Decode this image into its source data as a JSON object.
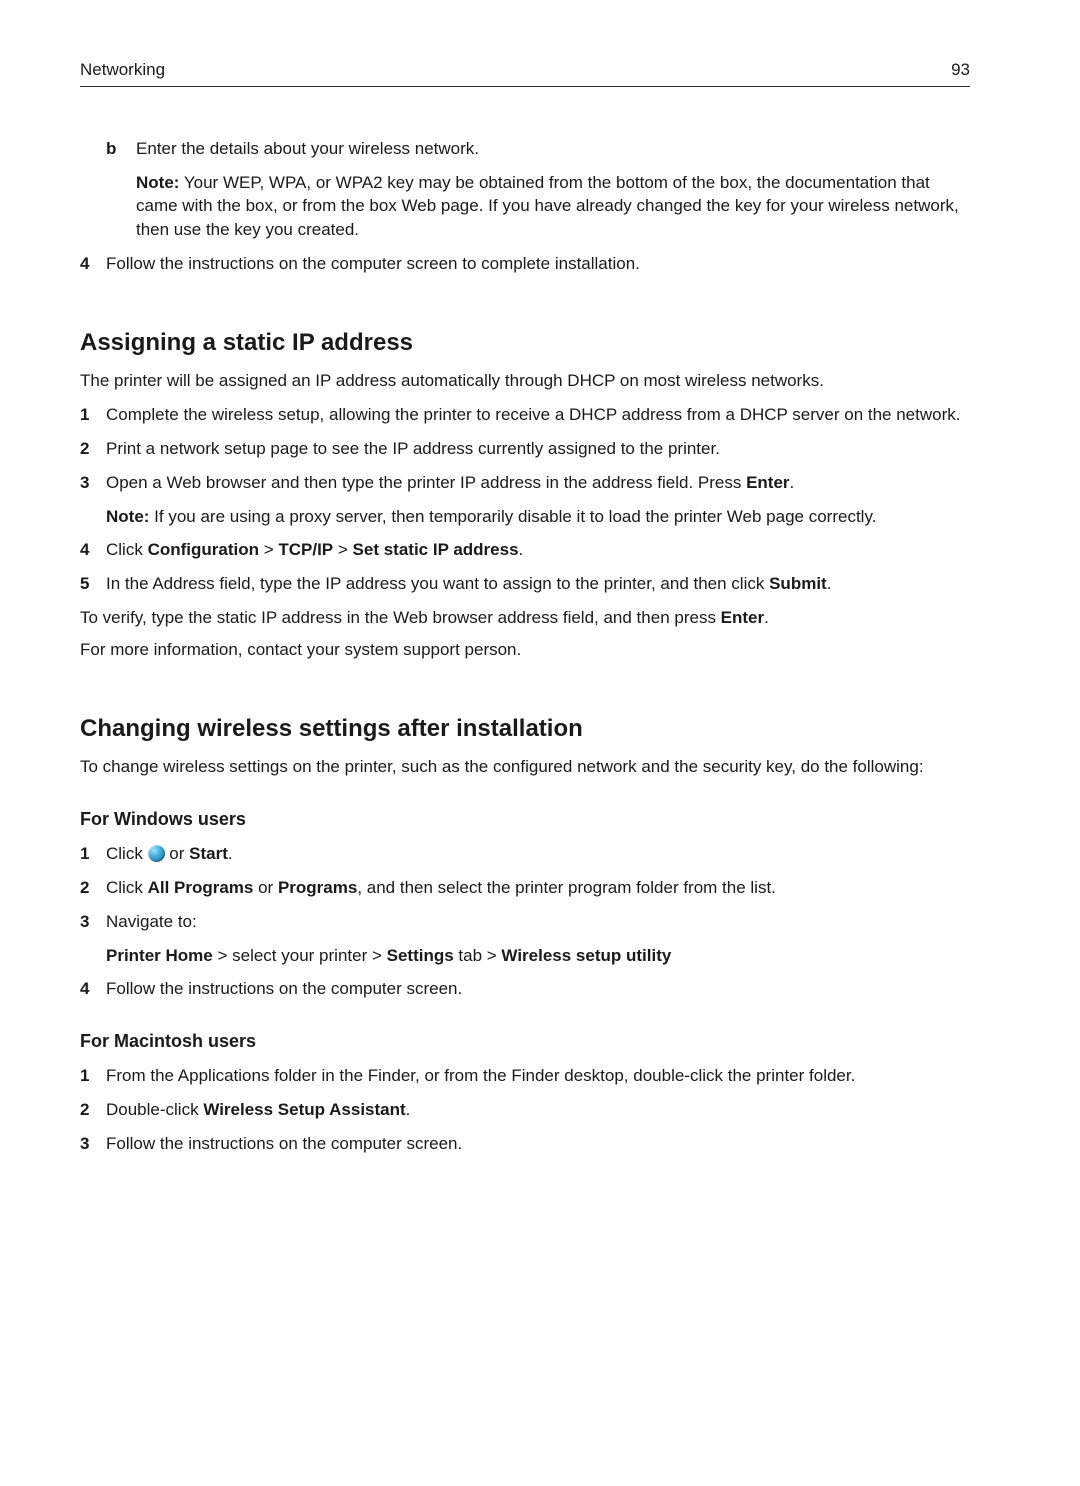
{
  "header": {
    "section": "Networking",
    "page_number": "93"
  },
  "top_fragment": {
    "b_marker": "b",
    "b_text": "Enter the details about your wireless network.",
    "note_label": "Note:",
    "note_text": " Your WEP, WPA, or WPA2 key may be obtained from the bottom of the box, the documentation that came with the box, or from the box Web page. If you have already changed the key for your wireless network, then use the key you created.",
    "step4_num": "4",
    "step4_text": "Follow the instructions on the computer screen to complete installation."
  },
  "static_ip": {
    "title": "Assigning a static IP address",
    "intro": "The printer will be assigned an IP address automatically through DHCP on most wireless networks.",
    "s1_num": "1",
    "s1_text": "Complete the wireless setup, allowing the printer to receive a DHCP address from a DHCP server on the network.",
    "s2_num": "2",
    "s2_text": "Print a network setup page to see the IP address currently assigned to the printer.",
    "s3_num": "3",
    "s3_pre": "Open a Web browser and then type the printer IP address in the address field. Press ",
    "s3_bold": "Enter",
    "s3_post": ".",
    "s3_note_label": "Note:",
    "s3_note_text": " If you are using a proxy server, then temporarily disable it to load the printer Web page correctly.",
    "s4_num": "4",
    "s4_pre": "Click ",
    "s4_b1": "Configuration",
    "s4_sep1": " > ",
    "s4_b2": "TCP/IP",
    "s4_sep2": " > ",
    "s4_b3": "Set static IP address",
    "s4_post": ".",
    "s5_num": "5",
    "s5_pre": "In the Address field, type the IP address you want to assign to the printer, and then click ",
    "s5_bold": "Submit",
    "s5_post": ".",
    "verify_pre": "To verify, type the static IP address in the Web browser address field, and then press ",
    "verify_bold": "Enter",
    "verify_post": ".",
    "more_info": "For more information, contact your system support person."
  },
  "changing": {
    "title": "Changing wireless settings after installation",
    "intro": "To change wireless settings on the printer, such as the configured network and the security key, do the following:",
    "win_title": "For Windows users",
    "w1_num": "1",
    "w1_pre": "Click ",
    "w1_mid": " or ",
    "w1_bold": "Start",
    "w1_post": ".",
    "w2_num": "2",
    "w2_pre": "Click ",
    "w2_b1": "All Programs",
    "w2_mid": " or ",
    "w2_b2": "Programs",
    "w2_post": ", and then select the printer program folder from the list.",
    "w3_num": "3",
    "w3_text": "Navigate to:",
    "w3_path_b1": "Printer Home",
    "w3_path_t1": " > select your printer > ",
    "w3_path_b2": "Settings",
    "w3_path_t2": " tab > ",
    "w3_path_b3": "Wireless setup utility",
    "w4_num": "4",
    "w4_text": "Follow the instructions on the computer screen.",
    "mac_title": "For Macintosh users",
    "m1_num": "1",
    "m1_text": "From the Applications folder in the Finder, or from the Finder desktop, double-click the printer folder.",
    "m2_num": "2",
    "m2_pre": "Double‑click ",
    "m2_bold": "Wireless Setup Assistant",
    "m2_post": ".",
    "m3_num": "3",
    "m3_text": "Follow the instructions on the computer screen."
  }
}
